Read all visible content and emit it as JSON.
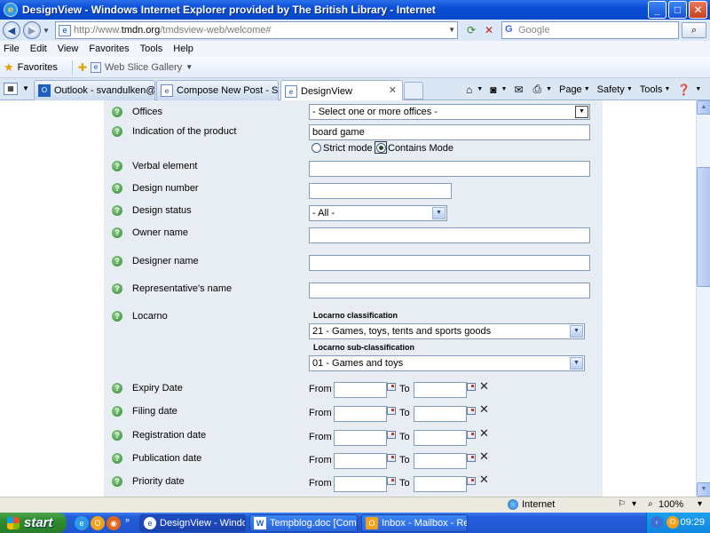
{
  "window": {
    "title": "DesignView - Windows Internet Explorer provided by The British Library - Internet",
    "minimize": "_",
    "maximize": "□",
    "close": "✕"
  },
  "address": {
    "url_prefix": "http://www.",
    "url_host": "tmdn.org",
    "url_path": "/tmdsview-web/welcome#",
    "search_placeholder": "Google"
  },
  "menu": [
    "File",
    "Edit",
    "View",
    "Favorites",
    "Tools",
    "Help"
  ],
  "favorites_bar": {
    "favorites_label": "Favorites",
    "web_slice_label": "Web Slice Gallery"
  },
  "tabs": [
    {
      "label": "Outlook - svandulken@hotm...",
      "icon": "outlook-icon"
    },
    {
      "label": "Compose New Post - Steve v...",
      "icon": "ie-page-icon"
    },
    {
      "label": "DesignView",
      "icon": "ie-page-icon",
      "active": true
    }
  ],
  "command_bar": {
    "page": "Page",
    "safety": "Safety",
    "tools": "Tools"
  },
  "form": {
    "offices": {
      "label": "Offices",
      "value": "- Select one or more offices -"
    },
    "indication": {
      "label": "Indication of the product",
      "value": "board game",
      "strict_mode": "Strict mode",
      "contains_mode": "Contains Mode"
    },
    "verbal": {
      "label": "Verbal element",
      "value": ""
    },
    "design_number": {
      "label": "Design number",
      "value": ""
    },
    "design_status": {
      "label": "Design status",
      "value": "- All -"
    },
    "owner_name": {
      "label": "Owner name",
      "value": ""
    },
    "designer_name": {
      "label": "Designer name",
      "value": ""
    },
    "representative": {
      "label": "Representative's name",
      "value": ""
    },
    "locarno": {
      "label": "Locarno",
      "classification_label": "Locarno classification",
      "classification_value": "21 - Games, toys, tents and sports goods",
      "subclassification_label": "Locarno sub-classification",
      "subclassification_value": "01 - Games and toys"
    },
    "from_label": "From",
    "to_label": "To",
    "dates": [
      {
        "label": "Expiry Date"
      },
      {
        "label": "Filing date"
      },
      {
        "label": "Registration date"
      },
      {
        "label": "Publication date"
      },
      {
        "label": "Priority date"
      }
    ]
  },
  "status_bar": {
    "zone": "Internet",
    "zoom": "100%"
  },
  "taskbar": {
    "start": "start",
    "items": [
      {
        "label": "DesignView - Window...",
        "icon": "ie-icon"
      },
      {
        "label": "Tempblog.doc [Comp...",
        "icon": "word-icon"
      },
      {
        "label": "Inbox - Mailbox - Res...",
        "icon": "outlook-icon"
      }
    ],
    "clock": "09:29"
  },
  "colors": {
    "titlebar": "#0a4fd6",
    "form_panel": "#e8ecf3",
    "help_icon": "#2f8a2f",
    "start_button": "#2e8a2e"
  }
}
